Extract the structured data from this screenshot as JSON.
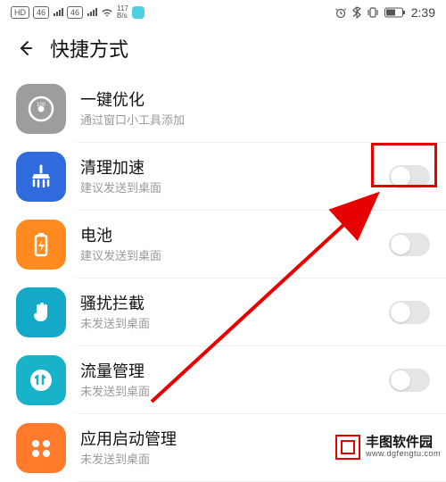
{
  "status": {
    "hd_badge": "HD",
    "net_badge_1": "46",
    "net_badge_2": "46",
    "speed_value": "117",
    "speed_unit": "B/s",
    "time": "2:39"
  },
  "header": {
    "title": "快捷方式"
  },
  "items": [
    {
      "icon": "gauge-icon",
      "title": "一键优化",
      "subtitle": "通过窗口小工具添加",
      "has_toggle": false
    },
    {
      "icon": "broom-icon",
      "title": "清理加速",
      "subtitle": "建议发送到桌面",
      "has_toggle": true
    },
    {
      "icon": "battery-icon",
      "title": "电池",
      "subtitle": "建议发送到桌面",
      "has_toggle": true
    },
    {
      "icon": "hand-icon",
      "title": "骚扰拦截",
      "subtitle": "未发送到桌面",
      "has_toggle": true
    },
    {
      "icon": "data-icon",
      "title": "流量管理",
      "subtitle": "未发送到桌面",
      "has_toggle": true
    },
    {
      "icon": "apps-icon",
      "title": "应用启动管理",
      "subtitle": "未发送到桌面",
      "has_toggle": true
    }
  ],
  "watermark": {
    "line1": "丰图软件园",
    "line2": "www.dgfengtu.com"
  }
}
